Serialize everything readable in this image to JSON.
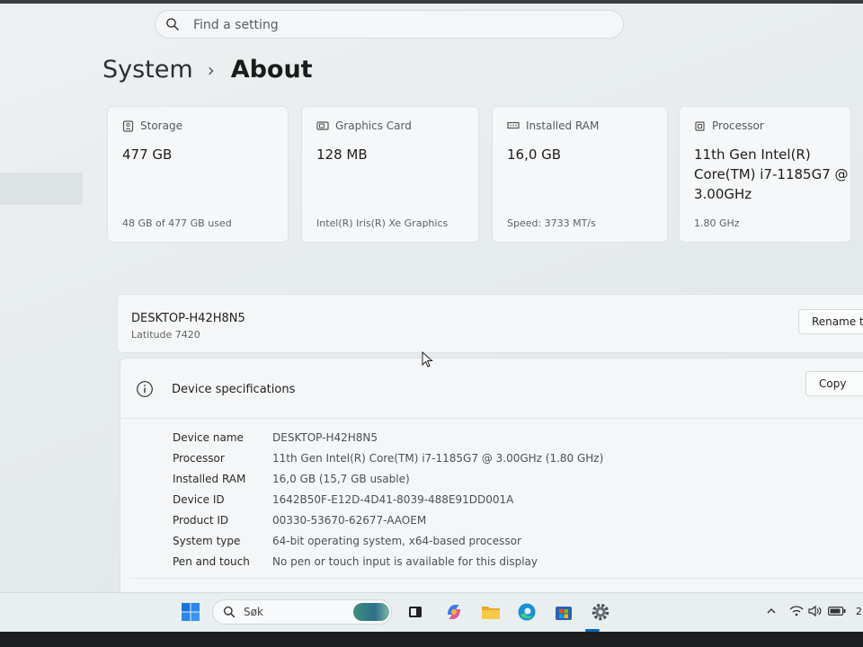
{
  "search": {
    "placeholder": "Find a setting"
  },
  "breadcrumb": {
    "parent": "System",
    "separator": "›",
    "current": "About"
  },
  "cards": [
    {
      "label": "Storage",
      "value": "477 GB",
      "sub": "48 GB of 477 GB used",
      "icon": "storage-icon"
    },
    {
      "label": "Graphics Card",
      "value": "128 MB",
      "sub": "Intel(R) Iris(R) Xe Graphics",
      "icon": "graphics-card-icon"
    },
    {
      "label": "Installed RAM",
      "value": "16,0 GB",
      "sub": "Speed: 3733 MT/s",
      "icon": "ram-icon"
    },
    {
      "label": "Processor",
      "value": "11th Gen Intel(R) Core(TM) i7-1185G7 @ 3.00GHz",
      "sub": "1.80 GHz",
      "icon": "processor-icon"
    }
  ],
  "device": {
    "name": "DESKTOP-H42H8N5",
    "model": "Latitude 7420",
    "rename_label": "Rename th"
  },
  "specs": {
    "title": "Device specifications",
    "copy_label": "Copy",
    "rows": [
      {
        "key": "Device name",
        "value": "DESKTOP-H42H8N5"
      },
      {
        "key": "Processor",
        "value": "11th Gen Intel(R) Core(TM) i7-1185G7 @ 3.00GHz (1.80 GHz)"
      },
      {
        "key": "Installed RAM",
        "value": "16,0 GB (15,7 GB usable)"
      },
      {
        "key": "Device ID",
        "value": "1642B50F-E12D-4D41-8039-488E91DD001A"
      },
      {
        "key": "Product ID",
        "value": "00330-53670-62677-AAOEM"
      },
      {
        "key": "System type",
        "value": "64-bit operating system, x64-based processor"
      },
      {
        "key": "Pen and touch",
        "value": "No pen or touch input is available for this display"
      }
    ]
  },
  "taskbar": {
    "search_label": "Søk",
    "clock_partial": "2",
    "accent": "#0067c0",
    "items": [
      "windows-start-icon",
      "task-view-icon",
      "copilot-icon",
      "file-explorer-icon",
      "edge-icon",
      "store-icon",
      "settings-icon"
    ],
    "tray": [
      "chevron-up-icon",
      "wifi-icon",
      "volume-icon",
      "battery-icon"
    ]
  }
}
